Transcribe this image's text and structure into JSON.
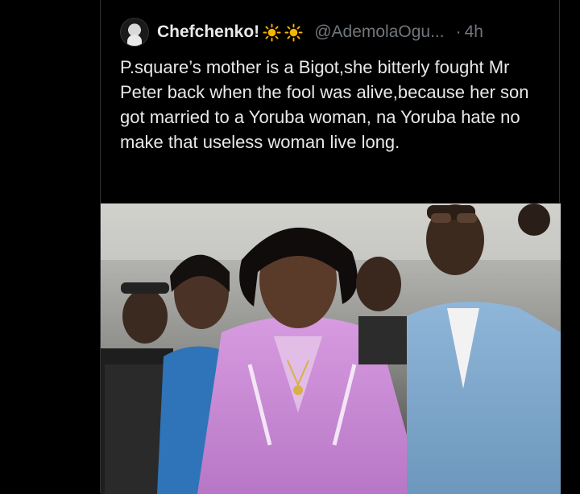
{
  "tweet": {
    "author": {
      "display_name": "Chefchenko!",
      "emoji_icons": [
        "sun-icon",
        "sun-icon"
      ],
      "handle": "@AdemolaOgu...",
      "separator": "·",
      "timestamp": "4h"
    },
    "text": "P.square’s mother is a Bigot,she bitterly fought Mr Peter back when the fool was alive,because her son got married to a Yoruba woman, na Yoruba hate no make that useless woman live long.",
    "media": {
      "type": "photo"
    }
  },
  "colors": {
    "background": "#000000",
    "text_primary": "#e7e9ea",
    "text_secondary": "#71767b",
    "border": "#2f3336",
    "sun_emoji": "#f5b400"
  }
}
